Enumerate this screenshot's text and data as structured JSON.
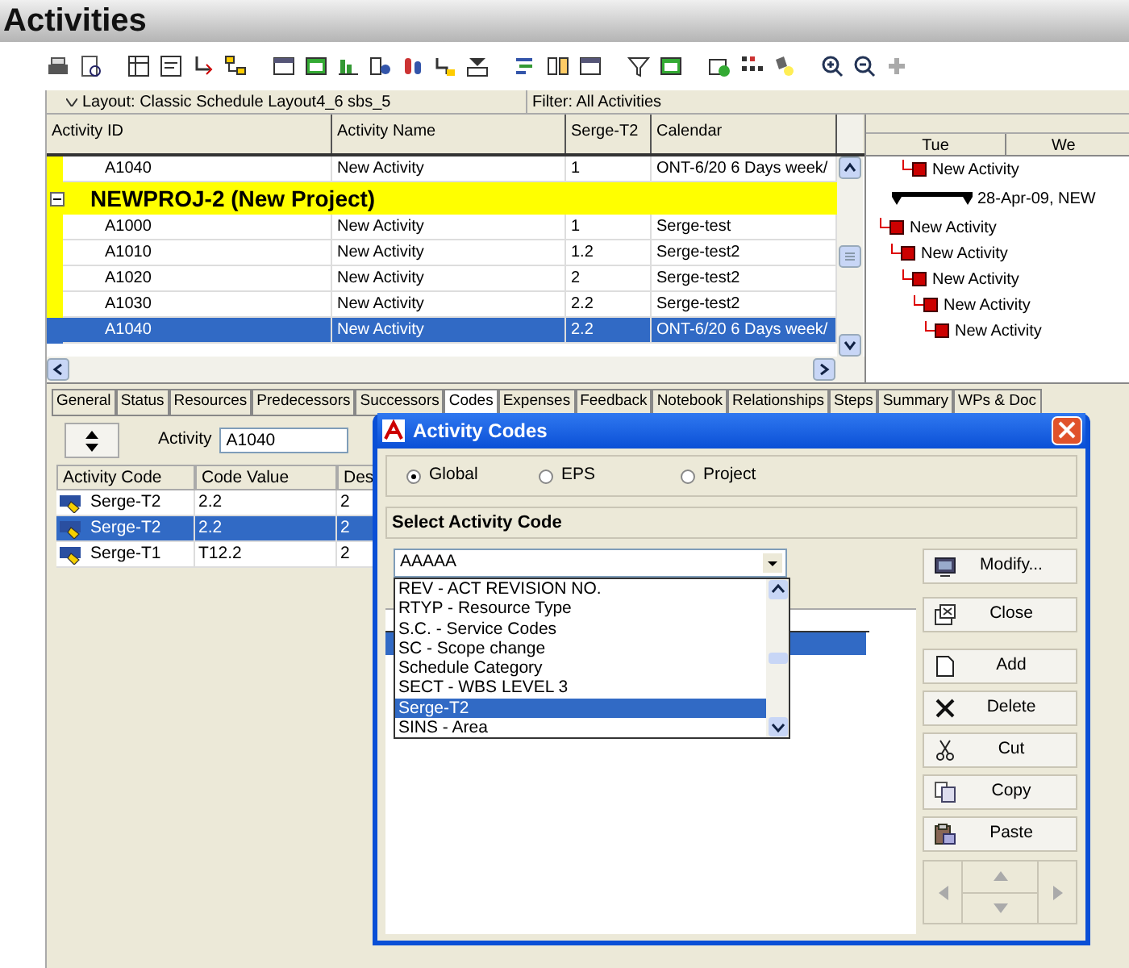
{
  "title": "Activities",
  "layout_bar": {
    "layout": "Layout: Classic Schedule Layout4_6 sbs_5",
    "filter": "Filter: All Activities"
  },
  "table": {
    "columns": [
      "Activity ID",
      "Activity Name",
      "Serge-T2",
      "Calendar"
    ],
    "rows": [
      {
        "kind": "activity",
        "cells": [
          "A1040",
          "New Activity",
          "1",
          "ONT-6/20 6 Days week/"
        ],
        "selected": false
      },
      {
        "kind": "group",
        "label": "NEWPROJ-2  (New Project)",
        "expanded": true
      },
      {
        "kind": "activity",
        "cells": [
          "A1000",
          "New Activity",
          "1",
          "Serge-test"
        ],
        "selected": false
      },
      {
        "kind": "activity",
        "cells": [
          "A1010",
          "New Activity",
          "1.2",
          "Serge-test2"
        ],
        "selected": false
      },
      {
        "kind": "activity",
        "cells": [
          "A1020",
          "New Activity",
          "2",
          "Serge-test2"
        ],
        "selected": false
      },
      {
        "kind": "activity",
        "cells": [
          "A1030",
          "New Activity",
          "2.2",
          "Serge-test2"
        ],
        "selected": false
      },
      {
        "kind": "activity",
        "cells": [
          "A1040",
          "New Activity",
          "2.2",
          "ONT-6/20 6 Days week/"
        ],
        "selected": true
      }
    ]
  },
  "gantt": {
    "columns": [
      "Tue",
      "We"
    ],
    "items": [
      {
        "kind": "task",
        "label": "New Activity"
      },
      {
        "kind": "summary",
        "label": "28-Apr-09, NEW"
      },
      {
        "kind": "task",
        "label": "New Activity"
      },
      {
        "kind": "task",
        "label": "New Activity"
      },
      {
        "kind": "task",
        "label": "New Activity"
      },
      {
        "kind": "task",
        "label": "New Activity"
      },
      {
        "kind": "task",
        "label": "New Activity"
      }
    ]
  },
  "details": {
    "tabs": [
      {
        "label": "General",
        "selected": false
      },
      {
        "label": "Status",
        "selected": false
      },
      {
        "label": "Resources",
        "selected": false
      },
      {
        "label": "Predecessors",
        "selected": false
      },
      {
        "label": "Successors",
        "selected": false
      },
      {
        "label": "Codes",
        "selected": true
      },
      {
        "label": "Expenses",
        "selected": false
      },
      {
        "label": "Feedback",
        "selected": false
      },
      {
        "label": "Notebook",
        "selected": false
      },
      {
        "label": "Relationships",
        "selected": false
      },
      {
        "label": "Steps",
        "selected": false
      },
      {
        "label": "Summary",
        "selected": false
      },
      {
        "label": "WPs & Doc",
        "selected": false
      }
    ],
    "activity_label": "Activity",
    "activity_value": "A1040",
    "codes_table": {
      "columns": [
        "Activity Code",
        "Code Value",
        "Des"
      ],
      "rows": [
        {
          "cells": [
            "Serge-T2",
            "2.2",
            "2"
          ],
          "selected": false
        },
        {
          "cells": [
            "Serge-T2",
            "2.2",
            "2"
          ],
          "selected": true
        },
        {
          "cells": [
            "Serge-T1",
            "T12.2",
            "2"
          ],
          "selected": false
        }
      ]
    }
  },
  "dialog": {
    "title": "Activity Codes",
    "scope_options": [
      {
        "label": "Global",
        "selected": true
      },
      {
        "label": "EPS",
        "selected": false
      },
      {
        "label": "Project",
        "selected": false
      }
    ],
    "section_title": "Select Activity Code",
    "dropdown": {
      "value": "AAAAA",
      "options": [
        {
          "label": "REV - ACT REVISION NO.",
          "selected": false
        },
        {
          "label": "RTYP - Resource Type",
          "selected": false
        },
        {
          "label": "S.C. - Service Codes",
          "selected": false
        },
        {
          "label": "SC - Scope change",
          "selected": false
        },
        {
          "label": "Schedule Category",
          "selected": false
        },
        {
          "label": "SECT - WBS LEVEL 3",
          "selected": false
        },
        {
          "label": "Serge-T2",
          "selected": true
        },
        {
          "label": "SINS - Area",
          "selected": false
        }
      ]
    },
    "grid": {
      "rows": [
        {
          "selected": true
        }
      ]
    },
    "buttons": [
      {
        "kind": "modify",
        "label": "Modify..."
      },
      {
        "kind": "close",
        "label": "Close"
      },
      {
        "kind": "add",
        "label": "Add"
      },
      {
        "kind": "delete",
        "label": "Delete"
      },
      {
        "kind": "cut",
        "label": "Cut"
      },
      {
        "kind": "copy",
        "label": "Copy"
      },
      {
        "kind": "paste",
        "label": "Paste"
      }
    ],
    "nav_pad": {
      "disabled": true
    }
  }
}
